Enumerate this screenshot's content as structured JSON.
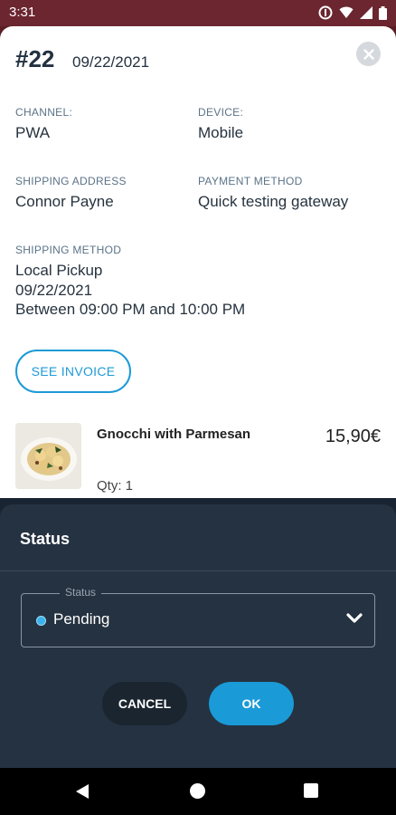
{
  "status_bar": {
    "time": "3:31"
  },
  "order": {
    "number": "#22",
    "date": "09/22/2021",
    "channel_label": "CHANNEL:",
    "channel_value": "PWA",
    "device_label": "DEVICE:",
    "device_value": "Mobile",
    "shipping_address_label": "SHIPPING ADDRESS",
    "shipping_address_value": "Connor Payne",
    "payment_method_label": "PAYMENT METHOD",
    "payment_method_value": "Quick testing gateway",
    "shipping_method_label": "SHIPPING METHOD",
    "shipping_method_lines": [
      "Local Pickup",
      "09/22/2021",
      "Between 09:00 PM and 10:00 PM"
    ],
    "invoice_button": "SEE INVOICE"
  },
  "product": {
    "name": "Gnocchi with Parmesan",
    "price": "15,90€",
    "qty": "Qty: 1"
  },
  "status_sheet": {
    "title": "Status",
    "field_label": "Status",
    "selected": "Pending",
    "cancel_label": "CANCEL",
    "ok_label": "OK"
  },
  "colors": {
    "accent": "#1d9ad6",
    "sheet_bg": "#253241",
    "status_bar_bg": "#6b2630"
  },
  "icons": {
    "close": "close-icon",
    "chevron": "chevron-down-icon",
    "status_dot": "pending-dot-icon"
  }
}
